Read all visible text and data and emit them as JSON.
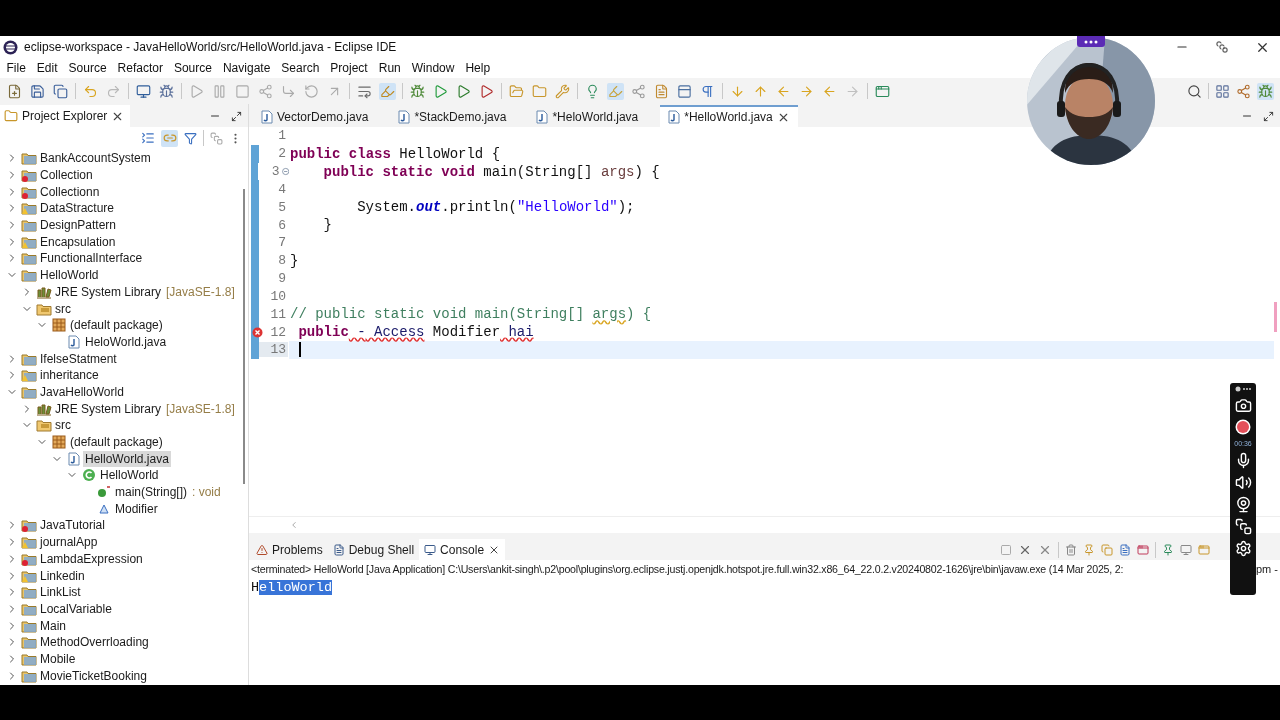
{
  "window": {
    "title": "eclipse-workspace - JavaHelloWorld/src/HelloWorld.java - Eclipse IDE"
  },
  "menu": [
    "File",
    "Edit",
    "Source",
    "Refactor",
    "Source",
    "Navigate",
    "Search",
    "Project",
    "Run",
    "Window",
    "Help"
  ],
  "explorer": {
    "title": "Project Explorer",
    "tree": [
      {
        "label": "BankAccountSystem",
        "kind": "project",
        "expandable": true,
        "expanded": false
      },
      {
        "label": "Collection",
        "kind": "project-error",
        "expandable": true,
        "expanded": false
      },
      {
        "label": "Collectionn",
        "kind": "project-error",
        "expandable": true,
        "expanded": false
      },
      {
        "label": "DataStracture",
        "kind": "project-warning",
        "expandable": true,
        "expanded": false
      },
      {
        "label": "DesignPattern",
        "kind": "project",
        "expandable": true,
        "expanded": false
      },
      {
        "label": "Encapsulation",
        "kind": "project-warning",
        "expandable": true,
        "expanded": false
      },
      {
        "label": "FunctionalInterface",
        "kind": "project",
        "expandable": true,
        "expanded": false
      },
      {
        "label": "HelloWorld",
        "kind": "project",
        "expandable": true,
        "expanded": true,
        "children": [
          {
            "label": "JRE System Library",
            "suffix": "[JavaSE-1.8]",
            "kind": "library",
            "expandable": true,
            "expanded": false
          },
          {
            "label": "src",
            "kind": "folder",
            "expandable": true,
            "expanded": true,
            "children": [
              {
                "label": "(default package)",
                "kind": "package",
                "expandable": true,
                "expanded": true,
                "children": [
                  {
                    "label": "HeloWorld.java",
                    "kind": "file",
                    "expandable": false
                  }
                ]
              }
            ]
          }
        ]
      },
      {
        "label": "IfelseStatment",
        "kind": "project",
        "expandable": true,
        "expanded": false
      },
      {
        "label": "inheritance",
        "kind": "project-warning",
        "expandable": true,
        "expanded": false
      },
      {
        "label": "JavaHelloWorld",
        "kind": "project",
        "expandable": true,
        "expanded": true,
        "children": [
          {
            "label": "JRE System Library",
            "suffix": "[JavaSE-1.8]",
            "kind": "library",
            "expandable": true,
            "expanded": false
          },
          {
            "label": "src",
            "kind": "folder",
            "expandable": true,
            "expanded": true,
            "children": [
              {
                "label": "(default package)",
                "kind": "package",
                "expandable": true,
                "expanded": true,
                "children": [
                  {
                    "label": "HelloWorld.java",
                    "kind": "file",
                    "expandable": true,
                    "expanded": true,
                    "selected": true,
                    "children": [
                      {
                        "label": "HelloWorld",
                        "kind": "class",
                        "expandable": true,
                        "expanded": true,
                        "children": [
                          {
                            "label": "main(String[])",
                            "suffix": ": void",
                            "kind": "method",
                            "expandable": false
                          },
                          {
                            "label": "Modifier",
                            "kind": "field",
                            "expandable": false
                          }
                        ]
                      }
                    ]
                  }
                ]
              }
            ]
          }
        ]
      },
      {
        "label": "JavaTutorial",
        "kind": "project-error",
        "expandable": true,
        "expanded": false
      },
      {
        "label": "journalApp",
        "kind": "project-warning",
        "expandable": true,
        "expanded": false
      },
      {
        "label": "LambdaExpression",
        "kind": "project-error",
        "expandable": true,
        "expanded": false
      },
      {
        "label": "Linkedin",
        "kind": "project-warning",
        "expandable": true,
        "expanded": false
      },
      {
        "label": "LinkList",
        "kind": "project",
        "expandable": true,
        "expanded": false
      },
      {
        "label": "LocalVariable",
        "kind": "project",
        "expandable": true,
        "expanded": false
      },
      {
        "label": "Main",
        "kind": "project",
        "expandable": true,
        "expanded": false
      },
      {
        "label": "MethodOverrloading",
        "kind": "project",
        "expandable": true,
        "expanded": false
      },
      {
        "label": "Mobile",
        "kind": "project",
        "expandable": true,
        "expanded": false
      },
      {
        "label": "MovieTicketBooking",
        "kind": "project",
        "expandable": true,
        "expanded": false
      }
    ]
  },
  "editor": {
    "tabs": [
      {
        "label": "VectorDemo.java",
        "selected": false
      },
      {
        "label": "*StackDemo.java",
        "selected": false
      },
      {
        "label": "*HeloWorld.java",
        "selected": false
      },
      {
        "label": "*HelloWorld.java",
        "selected": true
      }
    ],
    "lines": [
      {
        "number": "1",
        "changed": false,
        "current": false,
        "foldable": false,
        "has_error": false
      },
      {
        "number": "2",
        "changed": true,
        "current": false,
        "foldable": false,
        "has_error": false,
        "tokens": [
          {
            "text": "public",
            "kind": "keyword"
          },
          {
            "text": " class",
            "kind": "keyword"
          },
          {
            "text": " HelloWorld {",
            "kind": "plain"
          }
        ]
      },
      {
        "number": "3",
        "changed": true,
        "current": false,
        "foldable": true,
        "has_error": false,
        "tokens": [
          {
            "text": "    public static void",
            "kind": "keyword"
          },
          {
            "text": " main(String[] ",
            "kind": "plain"
          },
          {
            "text": "args",
            "kind": "param"
          },
          {
            "text": ") {",
            "kind": "plain"
          }
        ]
      },
      {
        "number": "4",
        "changed": true,
        "current": false,
        "foldable": false,
        "has_error": false
      },
      {
        "number": "5",
        "changed": true,
        "current": false,
        "foldable": false,
        "has_error": false,
        "tokens": [
          {
            "text": "        System.",
            "kind": "plain"
          },
          {
            "text": "out",
            "kind": "field"
          },
          {
            "text": ".println(",
            "kind": "plain"
          },
          {
            "text": "\"HelloWorld\"",
            "kind": "string"
          },
          {
            "text": ");",
            "kind": "plain"
          }
        ]
      },
      {
        "number": "6",
        "changed": true,
        "current": false,
        "foldable": false,
        "has_error": false,
        "tokens": [
          {
            "text": "    }",
            "kind": "plain"
          }
        ]
      },
      {
        "number": "7",
        "changed": true,
        "current": false,
        "foldable": false,
        "has_error": false
      },
      {
        "number": "8",
        "changed": true,
        "current": false,
        "foldable": false,
        "has_error": false,
        "tokens": [
          {
            "text": "}",
            "kind": "plain"
          }
        ]
      },
      {
        "number": "9",
        "changed": true,
        "current": false,
        "foldable": false,
        "has_error": false
      },
      {
        "number": "10",
        "changed": true,
        "current": false,
        "foldable": false,
        "has_error": false
      },
      {
        "number": "11",
        "changed": true,
        "current": false,
        "foldable": false,
        "has_error": false,
        "tokens": [
          {
            "text": "// public static void main(String[] ",
            "kind": "comment"
          },
          {
            "text": "args",
            "kind": "comment-warning"
          },
          {
            "text": ") {",
            "kind": "comment"
          }
        ]
      },
      {
        "number": "12",
        "changed": true,
        "current": false,
        "foldable": false,
        "has_error": true,
        "tokens": [
          {
            "text": " public",
            "kind": "keyword"
          },
          {
            "text": " -",
            "kind": "plain-error"
          },
          {
            "text": " Access",
            "kind": "plain-error"
          },
          {
            "text": " Modifier",
            "kind": "plain"
          },
          {
            "text": " hai",
            "kind": "plain-error"
          }
        ]
      },
      {
        "number": "13",
        "changed": true,
        "current": true,
        "foldable": false,
        "has_error": false
      }
    ]
  },
  "console": {
    "tabs": [
      {
        "label": "Problems",
        "selected": false
      },
      {
        "label": "Debug Shell",
        "selected": false
      },
      {
        "label": "Console",
        "selected": true
      }
    ],
    "header": "<terminated> HelloWorld [Java Application] C:\\Users\\ankit-singh\\.p2\\pool\\plugins\\org.eclipse.justj.openjdk.hotspot.jre.full.win32.x86_64_22.0.2.v20240802-1626\\jre\\bin\\javaw.exe  (14 Mar 2025, 2:",
    "header_tail": "pm -",
    "output": [
      {
        "text": "H",
        "selected": false
      },
      {
        "text": "elloWorld",
        "selected": true
      }
    ]
  },
  "recorder": {
    "timer": "00:36"
  }
}
